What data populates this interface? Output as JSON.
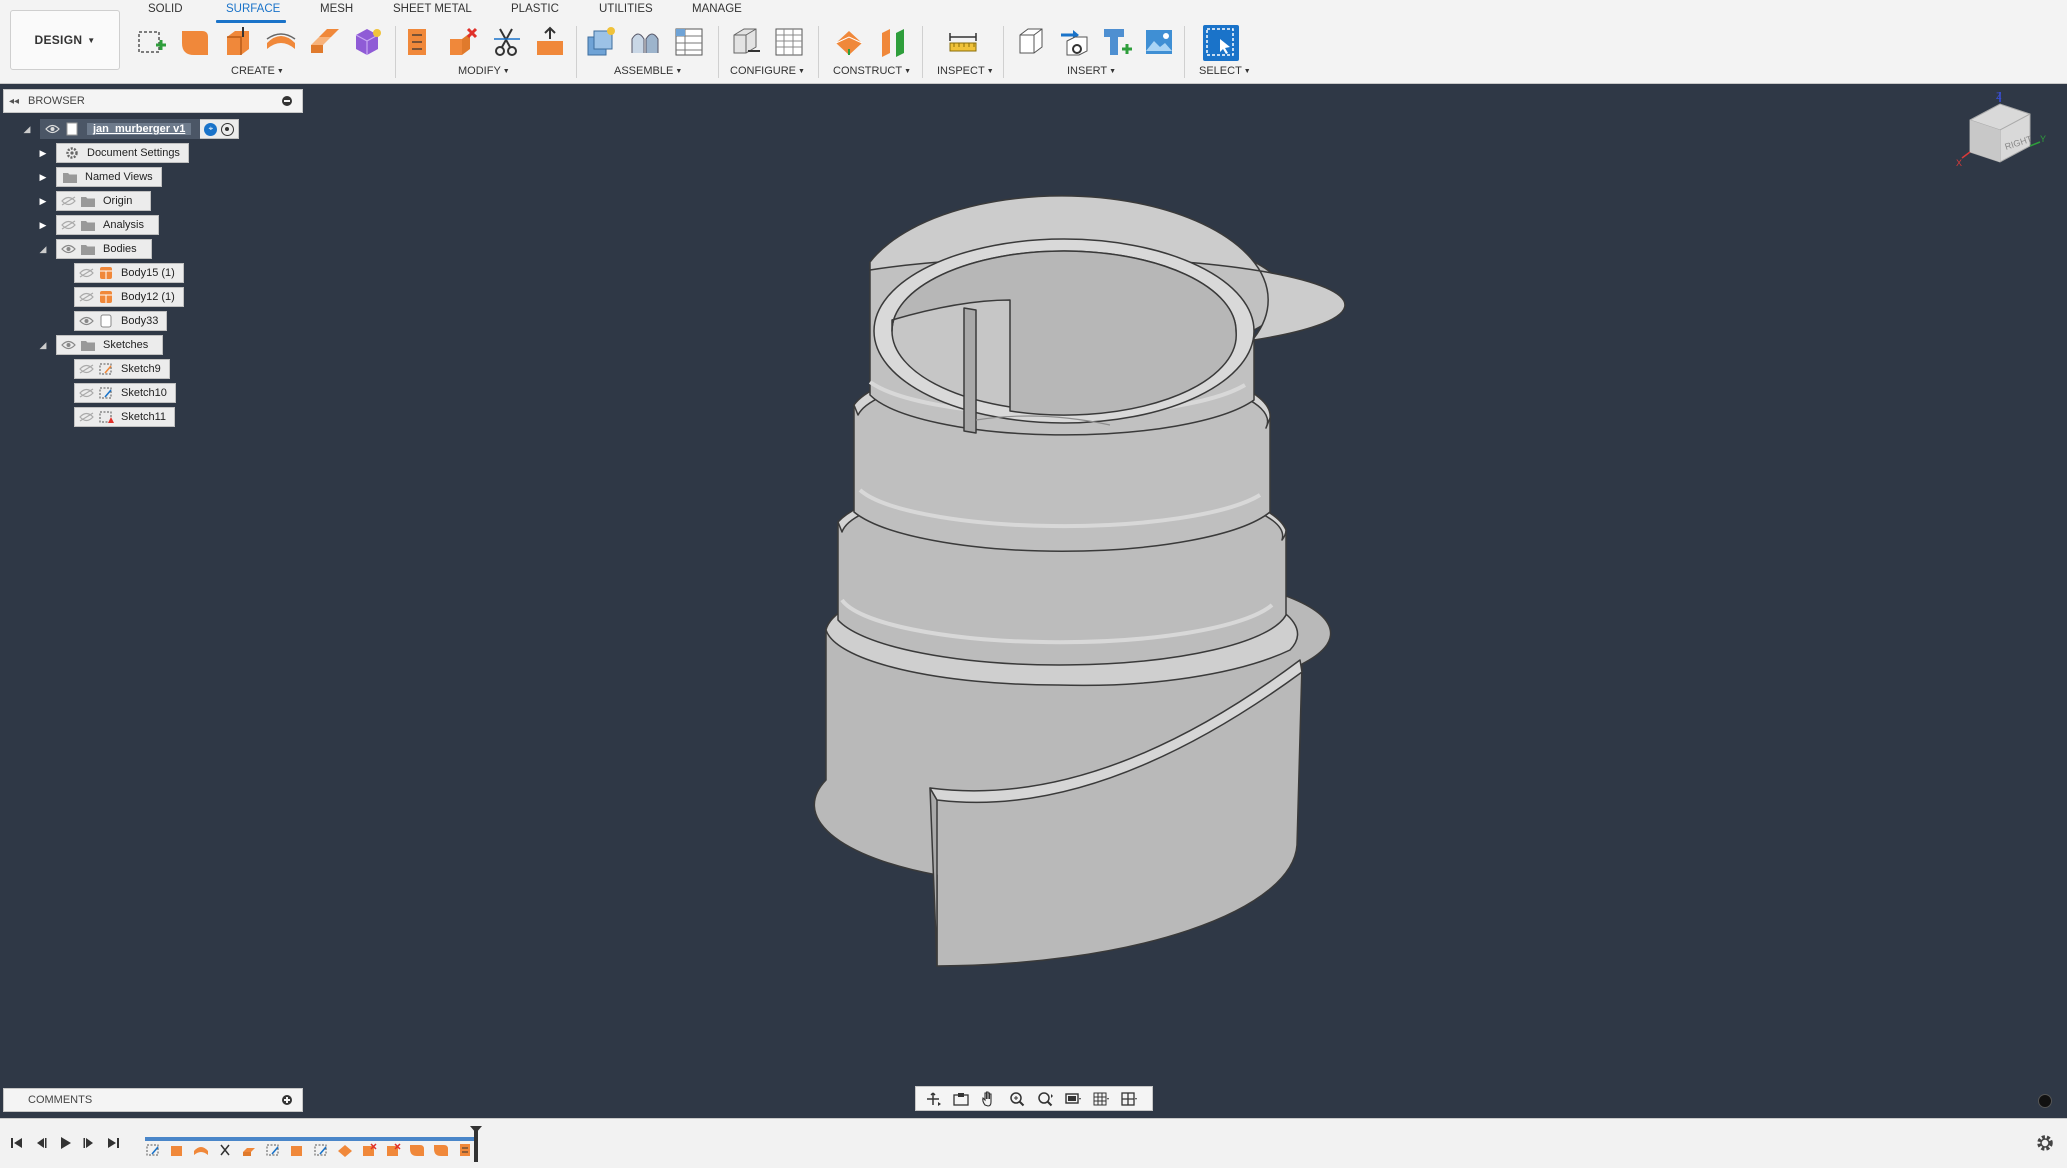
{
  "workspace": {
    "label": "DESIGN"
  },
  "tabs": [
    {
      "label": "SOLID",
      "active": false
    },
    {
      "label": "SURFACE",
      "active": true
    },
    {
      "label": "MESH",
      "active": false
    },
    {
      "label": "SHEET METAL",
      "active": false
    },
    {
      "label": "PLASTIC",
      "active": false
    },
    {
      "label": "UTILITIES",
      "active": false
    },
    {
      "label": "MANAGE",
      "active": false
    }
  ],
  "toolbar_groups": {
    "create": "CREATE",
    "modify": "MODIFY",
    "assemble": "ASSEMBLE",
    "configure": "CONFIGURE",
    "construct": "CONSTRUCT",
    "inspect": "INSPECT",
    "insert": "INSERT",
    "select": "SELECT"
  },
  "browser": {
    "title": "BROWSER",
    "root": "jan_murberger v1",
    "items": {
      "document_settings": "Document Settings",
      "named_views": "Named Views",
      "origin": "Origin",
      "analysis": "Analysis",
      "bodies": "Bodies",
      "body15": "Body15 (1)",
      "body12": "Body12 (1)",
      "body33": "Body33",
      "sketches": "Sketches",
      "sketch9": "Sketch9",
      "sketch10": "Sketch10",
      "sketch11": "Sketch11"
    }
  },
  "comments": {
    "title": "COMMENTS"
  },
  "viewcube": {
    "face_label": "RIGHT",
    "axis_z": "Z",
    "axis_y": "Y",
    "axis_x": "X"
  },
  "colors": {
    "accent": "#1a73c9",
    "viewport_bg": "#2f3846",
    "model_fill": "#bdbdbd",
    "feature_orange": "#f0883a"
  }
}
